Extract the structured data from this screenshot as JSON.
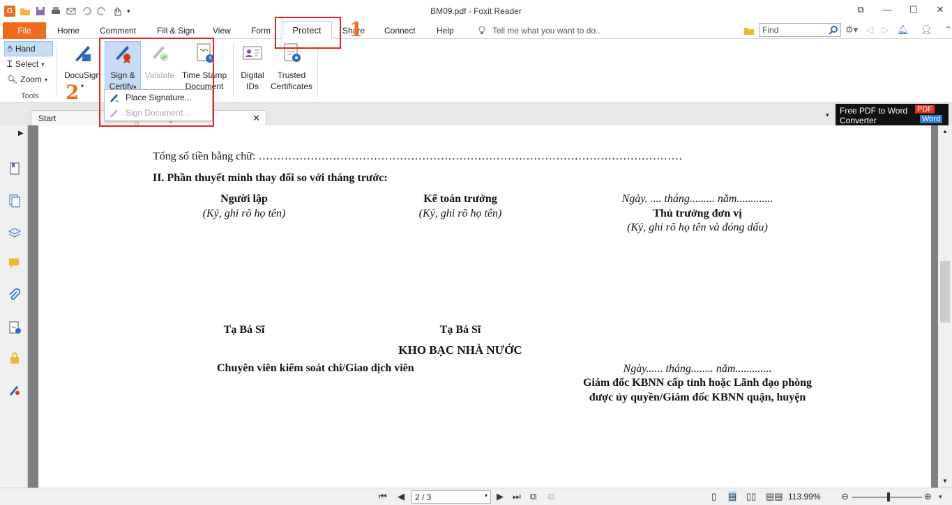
{
  "window": {
    "title": "BM09.pdf - Foxit Reader",
    "controls": [
      "⧉",
      "—",
      "☐",
      "✕"
    ]
  },
  "app_logo": "G",
  "menu_tabs": {
    "file": "File",
    "home": "Home",
    "comment": "Comment",
    "fill_sign": "Fill & Sign",
    "view": "View",
    "form": "Form",
    "protect": "Protect",
    "share": "Share",
    "connect": "Connect",
    "help": "Help",
    "tell_me": "Tell me what you want to do..",
    "find_placeholder": "Find"
  },
  "annotations": {
    "one": "1",
    "two": "2"
  },
  "ribbon": {
    "hand": "Hand",
    "select": "Select",
    "zoom": "Zoom",
    "tools_group": "Tools",
    "docusign": "DocuSign",
    "sign_certify_1": "Sign &",
    "sign_certify_2": "Certify",
    "validate": "Validate",
    "timestamp_1": "Time Stamp",
    "timestamp_2": "Document",
    "digital_ids_1": "Digital",
    "digital_ids_2": "IDs",
    "trusted_1": "Trusted",
    "trusted_2": "Certificates"
  },
  "dropdown": {
    "place_signature": "Place Signature...",
    "sign_document": "Sign Document..."
  },
  "doc_tabs": {
    "start": "Start",
    "current_partial": "BM09.pdf"
  },
  "ad": {
    "line1": "Free PDF to Word",
    "line2": "Converter",
    "pdf": "PDF",
    "word": "Word"
  },
  "document": {
    "total_words": "Tổng số tiền bằng chữ: ……………………………………………………………………………………………………",
    "section_ii": "II. Phần thuyết minh thay đổi so với tháng trước:",
    "preparer": "Người lập",
    "preparer_note": "(Ký, ghi rõ họ tên)",
    "chief_accountant": "Kế toán trưởng",
    "chief_accountant_note": "(Ký, ghi rõ họ tên)",
    "date_line_1": "Ngày. .... tháng......... năm.............",
    "unit_head": "Thủ trưởng đơn vị",
    "unit_head_note": "(Ký, ghi rõ họ tên và đóng dấu)",
    "signer1": "Tạ Bá Sĩ",
    "signer2": "Tạ Bá Sĩ",
    "treasury": "KHO BẠC NHÀ NƯỚC",
    "control_officer": "Chuyên viên kiểm soát chi/Giao dịch viên",
    "date_line_2": "Ngày...... tháng........ năm.............",
    "director_1": "Giám đốc KBNN cấp tỉnh hoặc Lãnh đạo phòng",
    "director_2": "được ủy quyền/Giám đốc KBNN quận, huyện"
  },
  "status": {
    "page": "2 / 3",
    "zoom": "113.99%"
  }
}
